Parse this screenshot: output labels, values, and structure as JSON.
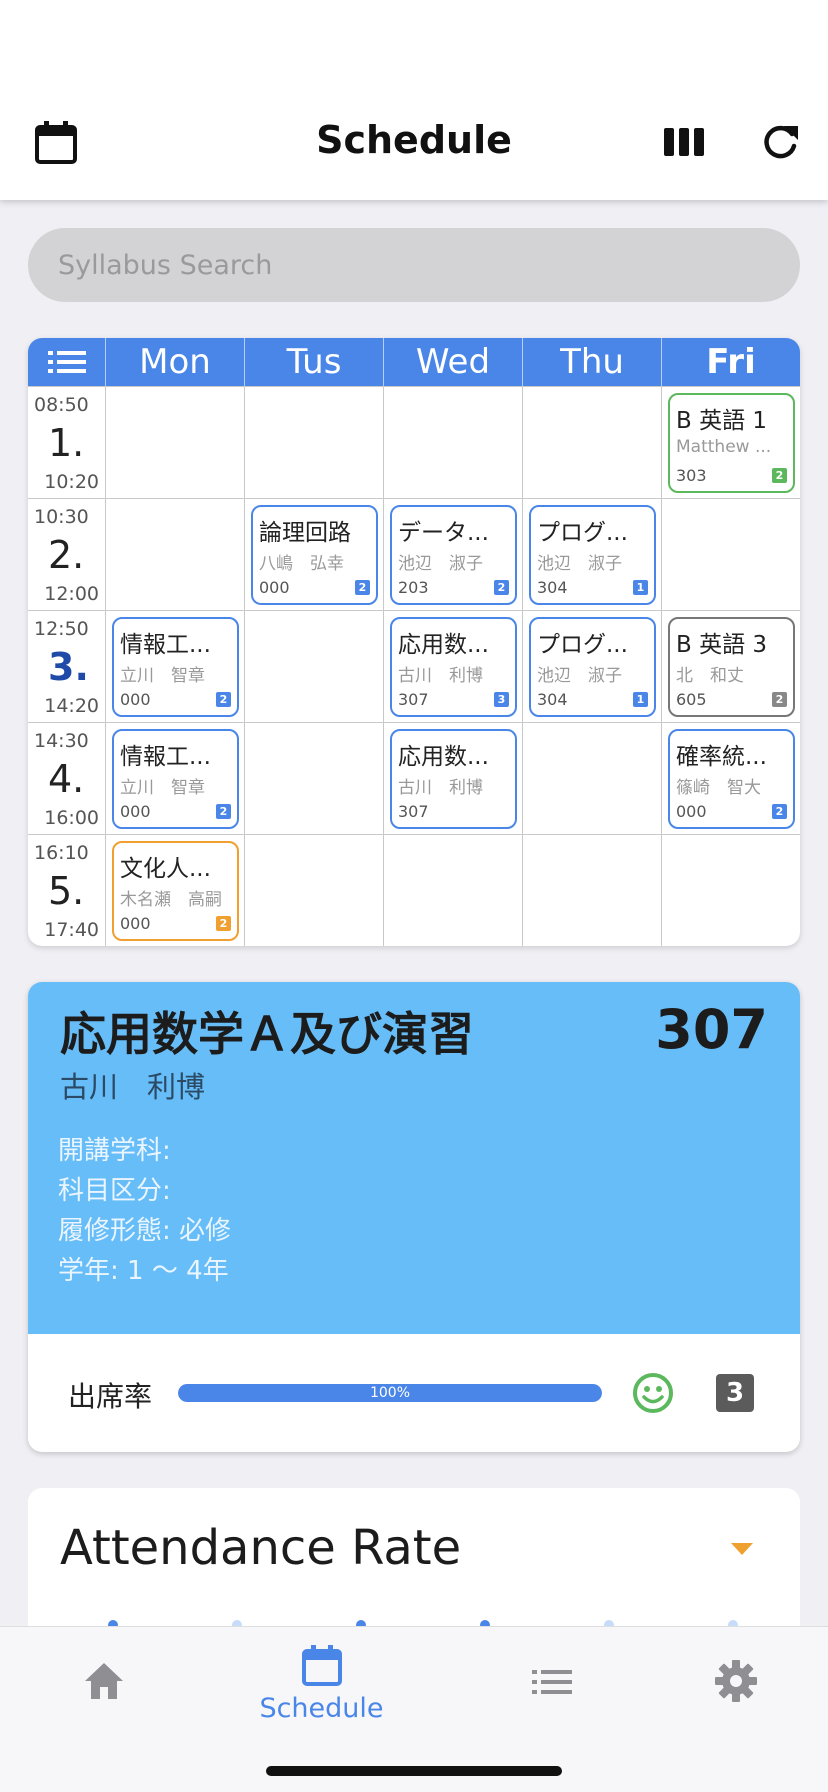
{
  "header": {
    "title": "Schedule",
    "left_icon": "calendar-icon",
    "right_icons": [
      "columns-icon",
      "refresh-icon"
    ]
  },
  "search": {
    "placeholder": "Syllabus Search"
  },
  "timetable": {
    "menu_icon": "list-icon",
    "days": [
      "Mon",
      "Tus",
      "Wed",
      "Thu",
      "Fri"
    ],
    "today_index": 4,
    "periods": [
      {
        "num": "1.",
        "start": "08:50",
        "end": "10:20",
        "current": false
      },
      {
        "num": "2.",
        "start": "10:30",
        "end": "12:00",
        "current": false
      },
      {
        "num": "3.",
        "start": "12:50",
        "end": "14:20",
        "current": true
      },
      {
        "num": "4.",
        "start": "14:30",
        "end": "16:00",
        "current": false
      },
      {
        "num": "5.",
        "start": "16:10",
        "end": "17:40",
        "current": false
      }
    ],
    "courses": [
      {
        "period": 0,
        "day": 4,
        "name": "B 英語 1",
        "prof": "Matthew ...",
        "room": "303",
        "credit": "2",
        "color": "green"
      },
      {
        "period": 1,
        "day": 1,
        "name": "論理回路",
        "prof": "八嶋　弘幸",
        "room": "000",
        "credit": "2",
        "color": "blue"
      },
      {
        "period": 1,
        "day": 2,
        "name": "データ...",
        "prof": "池辺　淑子",
        "room": "203",
        "credit": "2",
        "color": "blue"
      },
      {
        "period": 1,
        "day": 3,
        "name": "プログ...",
        "prof": "池辺　淑子",
        "room": "304",
        "credit": "1",
        "color": "blue"
      },
      {
        "period": 2,
        "day": 0,
        "name": "情報工...",
        "prof": "立川　智章",
        "room": "000",
        "credit": "2",
        "color": "blue"
      },
      {
        "period": 2,
        "day": 2,
        "name": "応用数...",
        "prof": "古川　利博",
        "room": "307",
        "credit": "3",
        "color": "blue"
      },
      {
        "period": 2,
        "day": 3,
        "name": "プログ...",
        "prof": "池辺　淑子",
        "room": "304",
        "credit": "1",
        "color": "blue"
      },
      {
        "period": 2,
        "day": 4,
        "name": "B 英語 3",
        "prof": "北　和丈",
        "room": "605",
        "credit": "2",
        "color": "gray"
      },
      {
        "period": 3,
        "day": 0,
        "name": "情報工...",
        "prof": "立川　智章",
        "room": "000",
        "credit": "2",
        "color": "blue"
      },
      {
        "period": 3,
        "day": 2,
        "name": "応用数...",
        "prof": "古川　利博",
        "room": "307",
        "credit": "",
        "color": "blue"
      },
      {
        "period": 3,
        "day": 4,
        "name": "確率統...",
        "prof": "篠崎　智大",
        "room": "000",
        "credit": "2",
        "color": "blue"
      },
      {
        "period": 4,
        "day": 0,
        "name": "文化人...",
        "prof": "木名瀬　高嗣",
        "room": "000",
        "credit": "2",
        "color": "orange"
      }
    ]
  },
  "detail": {
    "title": "応用数学Ａ及び演習",
    "room": "307",
    "professor": "古川　利博",
    "info": [
      "開講学科:",
      "科目区分:",
      "履修形態: 必修",
      "学年: 1 〜 4年"
    ],
    "attendance_label": "出席率",
    "attendance_rate": 100,
    "attendance_text": "100%",
    "mood_icon": "smile-icon",
    "credit_badge": "3"
  },
  "attendance_card": {
    "title": "Attendance Rate",
    "toggle_icon": "caret-down-icon"
  },
  "tabbar": {
    "items": [
      {
        "icon": "home-icon",
        "label": "",
        "active": false
      },
      {
        "icon": "calendar-icon",
        "label": "Schedule",
        "active": true
      },
      {
        "icon": "list-icon",
        "label": "",
        "active": false
      },
      {
        "icon": "gear-icon",
        "label": "",
        "active": false
      }
    ]
  },
  "colors": {
    "accent": "#4a86e8",
    "detail_bg": "#67bdf7",
    "green": "#5cb85c",
    "orange": "#f0a030",
    "gray": "#777777"
  }
}
